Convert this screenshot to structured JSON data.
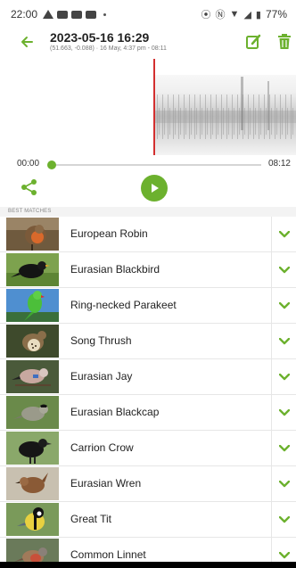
{
  "status_bar": {
    "time": "22:00",
    "battery": "77%",
    "icons": [
      "drive-icon",
      "youtube-icon",
      "youtube-icon",
      "youtube-icon",
      "dot",
      "vibrate-icon",
      "nfc-icon",
      "wifi-icon",
      "signal-icon",
      "battery-icon"
    ]
  },
  "header": {
    "title": "2023-05-16 16:29",
    "subtitle": "(51.663, -0.088) · 16 May, 4:37 pm - 08:11",
    "back_icon": "arrow-left-icon",
    "edit_icon": "edit-icon",
    "delete_icon": "trash-icon"
  },
  "player": {
    "current_time": "00:00",
    "duration": "08:12",
    "progress": 0,
    "playhead_color": "#d32f2f"
  },
  "colors": {
    "accent": "#6cb12e",
    "divider": "#e6e6e6",
    "section_bg": "#f3f3f3"
  },
  "section": {
    "label": "BEST MATCHES"
  },
  "matches": [
    {
      "name": "European Robin"
    },
    {
      "name": "Eurasian Blackbird"
    },
    {
      "name": "Ring-necked Parakeet"
    },
    {
      "name": "Song Thrush"
    },
    {
      "name": "Eurasian Jay"
    },
    {
      "name": "Eurasian Blackcap"
    },
    {
      "name": "Carrion Crow"
    },
    {
      "name": "Eurasian Wren"
    },
    {
      "name": "Great Tit"
    },
    {
      "name": "Common Linnet"
    }
  ]
}
